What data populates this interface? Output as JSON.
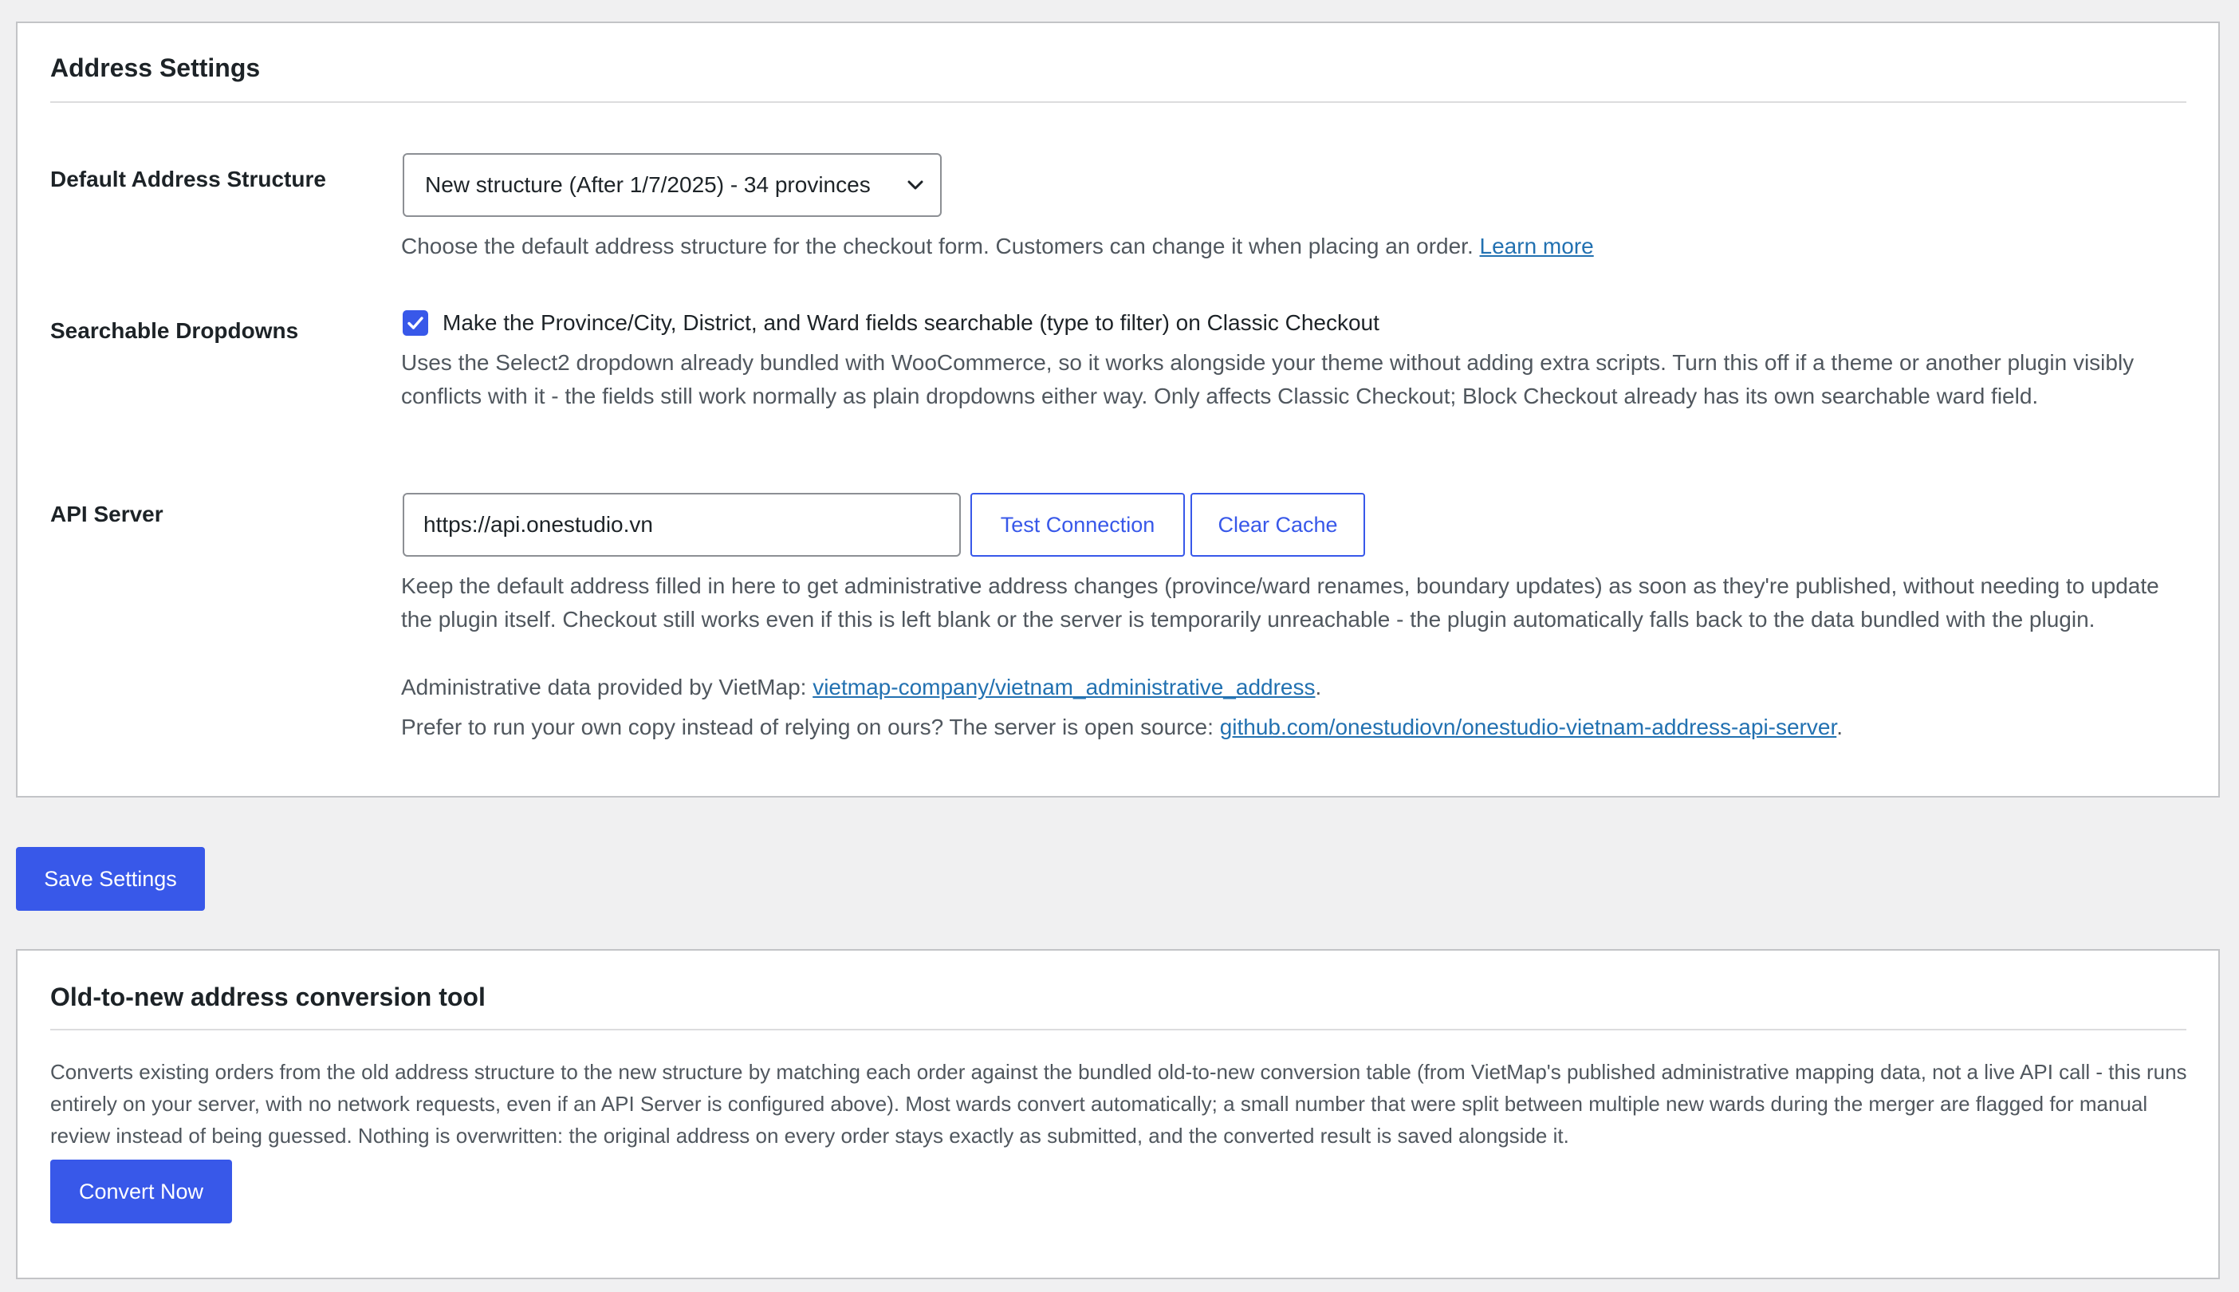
{
  "address_settings": {
    "title": "Address Settings",
    "default_structure": {
      "label": "Default Address Structure",
      "selected": "New structure (After 1/7/2025) - 34 provinces",
      "description": "Choose the default address structure for the checkout form. Customers can change it when placing an order. ",
      "learn_more": "Learn more"
    },
    "searchable": {
      "label": "Searchable Dropdowns",
      "checked": true,
      "checkbox_label": "Make the Province/City, District, and Ward fields searchable (type to filter) on Classic Checkout",
      "description": "Uses the Select2 dropdown already bundled with WooCommerce, so it works alongside your theme without adding extra scripts. Turn this off if a theme or another plugin visibly conflicts with it - the fields still work normally as plain dropdowns either way. Only affects Classic Checkout; Block Checkout already has its own searchable ward field."
    },
    "api_server": {
      "label": "API Server",
      "value": "https://api.onestudio.vn",
      "test_label": "Test Connection",
      "clear_label": "Clear Cache",
      "description": "Keep the default address filled in here to get administrative address changes (province/ward renames, boundary updates) as soon as they're published, without needing to update the plugin itself. Checkout still works even if this is left blank or the server is temporarily unreachable - the plugin automatically falls back to the data bundled with the plugin.",
      "data_prefix": "Administrative data provided by VietMap: ",
      "data_link": "vietmap-company/vietnam_administrative_address",
      "data_suffix": ".",
      "own_prefix": "Prefer to run your own copy instead of relying on ours? The server is open source: ",
      "own_link": "github.com/onestudiovn/onestudio-vietnam-address-api-server",
      "own_suffix": "."
    }
  },
  "save_label": "Save Settings",
  "conversion": {
    "title": "Old-to-new address conversion tool",
    "description": "Converts existing orders from the old address structure to the new structure by matching each order against the bundled old-to-new conversion table (from VietMap's published administrative mapping data, not a live API call - this runs entirely on your server, with no network requests, even if an API Server is configured above). Most wards convert automatically; a small number that were split between multiple new wards during the merger are flagged for manual review instead of being guessed. Nothing is overwritten: the original address on every order stays exactly as submitted, and the converted result is saved alongside it.",
    "button_label": "Convert Now"
  },
  "colors": {
    "accent": "#3858e9",
    "link": "#2271b1",
    "background": "#f0f0f1"
  }
}
